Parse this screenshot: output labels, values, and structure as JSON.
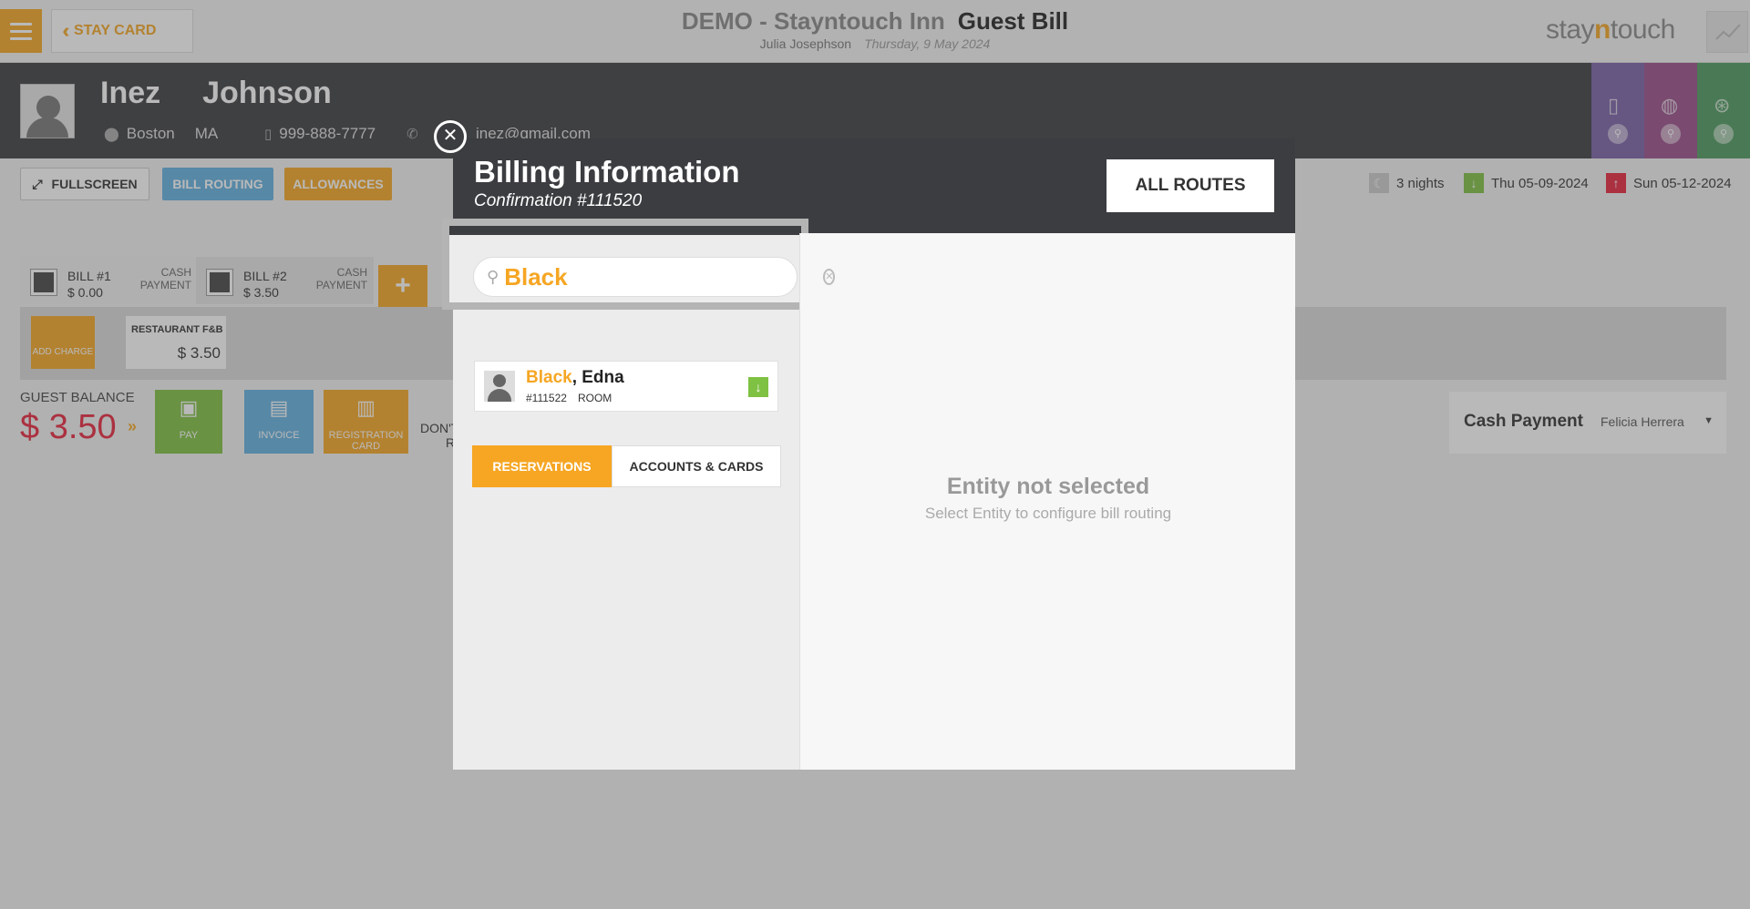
{
  "header": {
    "stay_card_label": "STAY CARD",
    "hotel": "DEMO - Stayntouch Inn",
    "page": "Guest Bill",
    "user": "Julia Josephson",
    "date": "Thursday, 9 May 2024",
    "logo_pre": "stay",
    "logo_n": "n",
    "logo_post": "touch"
  },
  "guest": {
    "first_name": "Inez",
    "last_name": "Johnson",
    "city": "Boston",
    "state": "MA",
    "phone": "999-888-7777",
    "email": "inez@gmail.com"
  },
  "toolbar": {
    "fullscreen": "FULLSCREEN",
    "bill_routing": "BILL ROUTING",
    "allowances": "ALLOWANCES"
  },
  "stay": {
    "nights": "3 nights",
    "arrival": "Thu 05-09-2024",
    "departure": "Sun 05-12-2024"
  },
  "bills": [
    {
      "label": "BILL #1",
      "amount": "$ 0.00",
      "payment": "CASH PAYMENT"
    },
    {
      "label": "BILL #2",
      "amount": "$ 3.50",
      "payment": "CASH PAYMENT"
    }
  ],
  "charges": {
    "add_charge": "ADD CHARGE",
    "restaurant_label": "RESTAURANT F&B",
    "restaurant_amount": "$ 3.50"
  },
  "balance": {
    "label": "GUEST BALANCE",
    "amount": "$ 3.50"
  },
  "actions": {
    "pay": "PAY",
    "invoice": "INVOICE",
    "registration_card": "REGISTRATION CARD",
    "dont_partial": "DON'T",
    "dont_partial2": "R"
  },
  "payment": {
    "method": "Cash Payment",
    "cashier": "Felicia Herrera"
  },
  "modal": {
    "title": "Billing Information",
    "confirmation": "Confirmation #111520",
    "all_routes": "ALL ROUTES",
    "search_value": "Black",
    "tabs": [
      "RESERVATIONS",
      "ACCOUNTS & CARDS"
    ],
    "result": {
      "last_name": "Black",
      "rest_name": ", Edna",
      "confirmation": "#111522",
      "type": "ROOM"
    },
    "empty_title": "Entity not selected",
    "empty_sub": "Select Entity to configure bill routing"
  },
  "colors": {
    "accent": "#f6a623",
    "dark": "#3b3d40",
    "blue": "#62b1e0",
    "green": "#7fc142",
    "red": "#e8253c"
  }
}
